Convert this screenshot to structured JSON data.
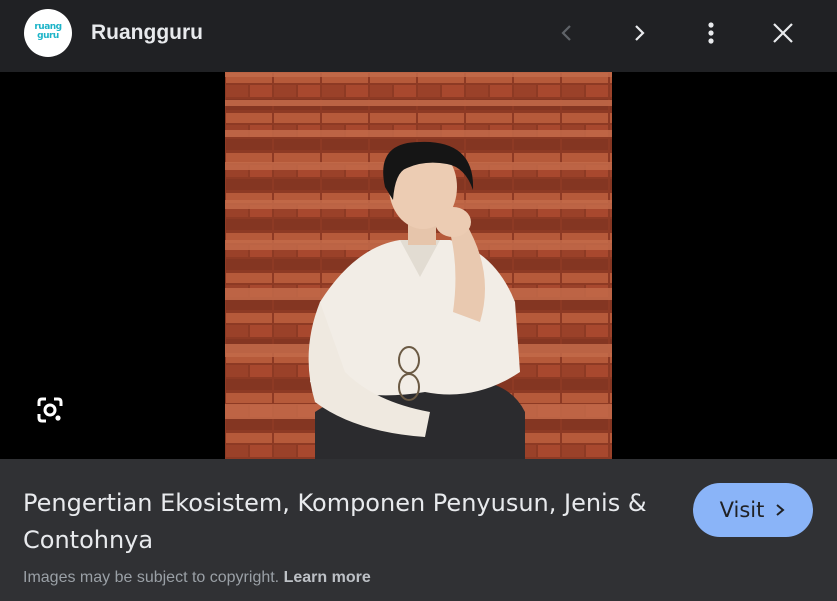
{
  "header": {
    "logo_text": "ruang guru",
    "site_name": "Ruangguru"
  },
  "icons": {
    "prev": "chevron-left-icon",
    "next": "chevron-right-icon",
    "more": "more-vert-icon",
    "close": "close-icon",
    "lens": "google-lens-icon",
    "visit": "chevron-right-icon"
  },
  "image": {
    "description_alt": "Photo of a person sitting on brick steps"
  },
  "footer": {
    "title": "Pengertian Ekosistem, Komponen Penyusun, Jenis & Contohnya",
    "visit_label": "Visit",
    "copyright_text": "Images may be subject to copyright.",
    "learn_more": "Learn more"
  },
  "colors": {
    "background": "#202124",
    "footer": "#303134",
    "accent": "#8ab4f8",
    "brick": "#a4452b"
  }
}
